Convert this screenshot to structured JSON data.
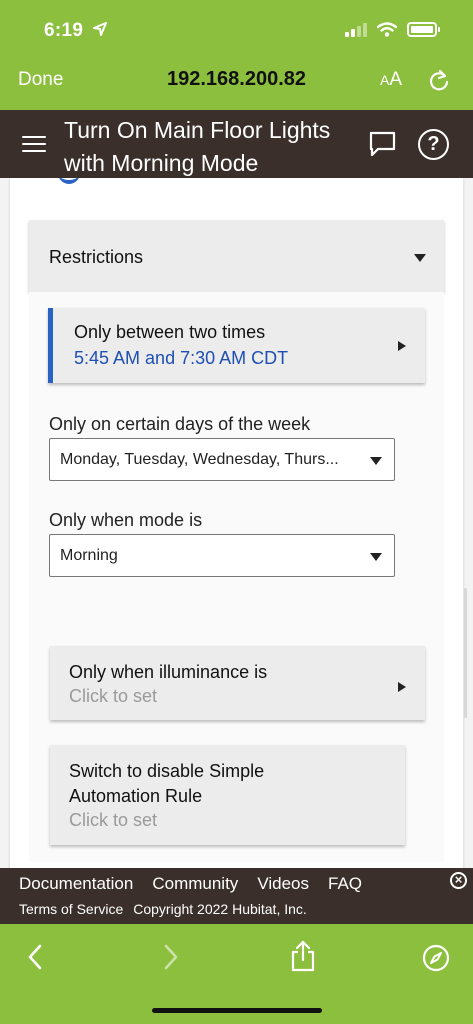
{
  "status_bar": {
    "time": "6:19"
  },
  "browser": {
    "done_label": "Done",
    "url": "192.168.200.82",
    "text_size_label": "AA"
  },
  "header": {
    "title_line1": "Turn On Main Floor Lights",
    "title_line2": "with Morning Mode"
  },
  "restrictions": {
    "label": "Restrictions",
    "time_restriction": {
      "title": "Only between two times",
      "value": "5:45 AM and 7:30 AM CDT"
    },
    "days": {
      "label": "Only on certain days of the week",
      "selected": "Monday, Tuesday, Wednesday, Thurs..."
    },
    "mode": {
      "label": "Only when mode is",
      "selected": "Morning"
    },
    "illuminance": {
      "title": "Only when illuminance is",
      "subtitle": "Click to set"
    },
    "disable_switch": {
      "title_line1": "Switch to disable Simple",
      "title_line2": "Automation Rule",
      "subtitle": "Click to set"
    }
  },
  "footer": {
    "links": [
      "Documentation",
      "Community",
      "Videos",
      "FAQ"
    ],
    "terms": "Terms of Service",
    "copyright": "Copyright 2022 Hubitat, Inc."
  },
  "colors": {
    "browser_chrome": "#8dbf3f",
    "header_bg": "#3a2f2a",
    "accent_blue": "#2a62c4"
  }
}
